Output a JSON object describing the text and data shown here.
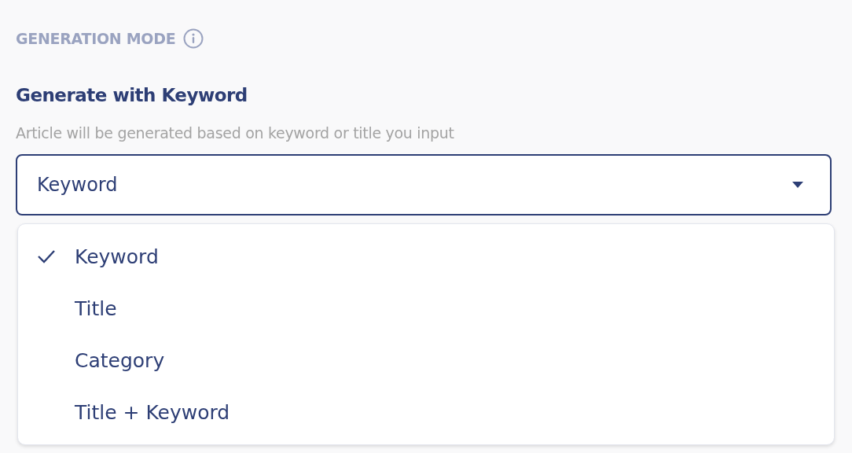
{
  "section": {
    "title": "GENERATION MODE"
  },
  "mode": {
    "heading": "Generate with Keyword",
    "description": "Article will be generated based on keyword or title you input"
  },
  "select": {
    "value": "Keyword",
    "expanded": true
  },
  "options": [
    {
      "label": "Keyword",
      "selected": true
    },
    {
      "label": "Title",
      "selected": false
    },
    {
      "label": "Category",
      "selected": false
    },
    {
      "label": "Title + Keyword",
      "selected": false
    }
  ]
}
